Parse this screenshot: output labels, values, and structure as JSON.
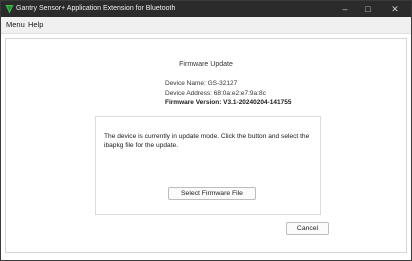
{
  "window": {
    "title": "Gantry Sensor+ Application Extension for Bluetooth",
    "icon": "app-logo-icon",
    "controls": {
      "minimize": "–",
      "maximize": "□",
      "close": "✕"
    }
  },
  "menubar": {
    "items": [
      {
        "label": "Menu"
      },
      {
        "label": "Help"
      }
    ]
  },
  "main": {
    "title": "Firmware Update",
    "device": {
      "name": "Device Name: GS-32127",
      "address": "Device Address: 68:0a:e2:e7:9a:8c",
      "firmware": "Firmware Version: V3.1-20240204-141755"
    },
    "panel": {
      "message": "The device is currently in update mode. Click the button and select the ibapkg file for the update.",
      "select_button": "Select Firmware File"
    },
    "cancel_button": "Cancel"
  },
  "colors": {
    "titlebar": "#2b2b2b",
    "accent_icon": "#3dbb4e"
  }
}
